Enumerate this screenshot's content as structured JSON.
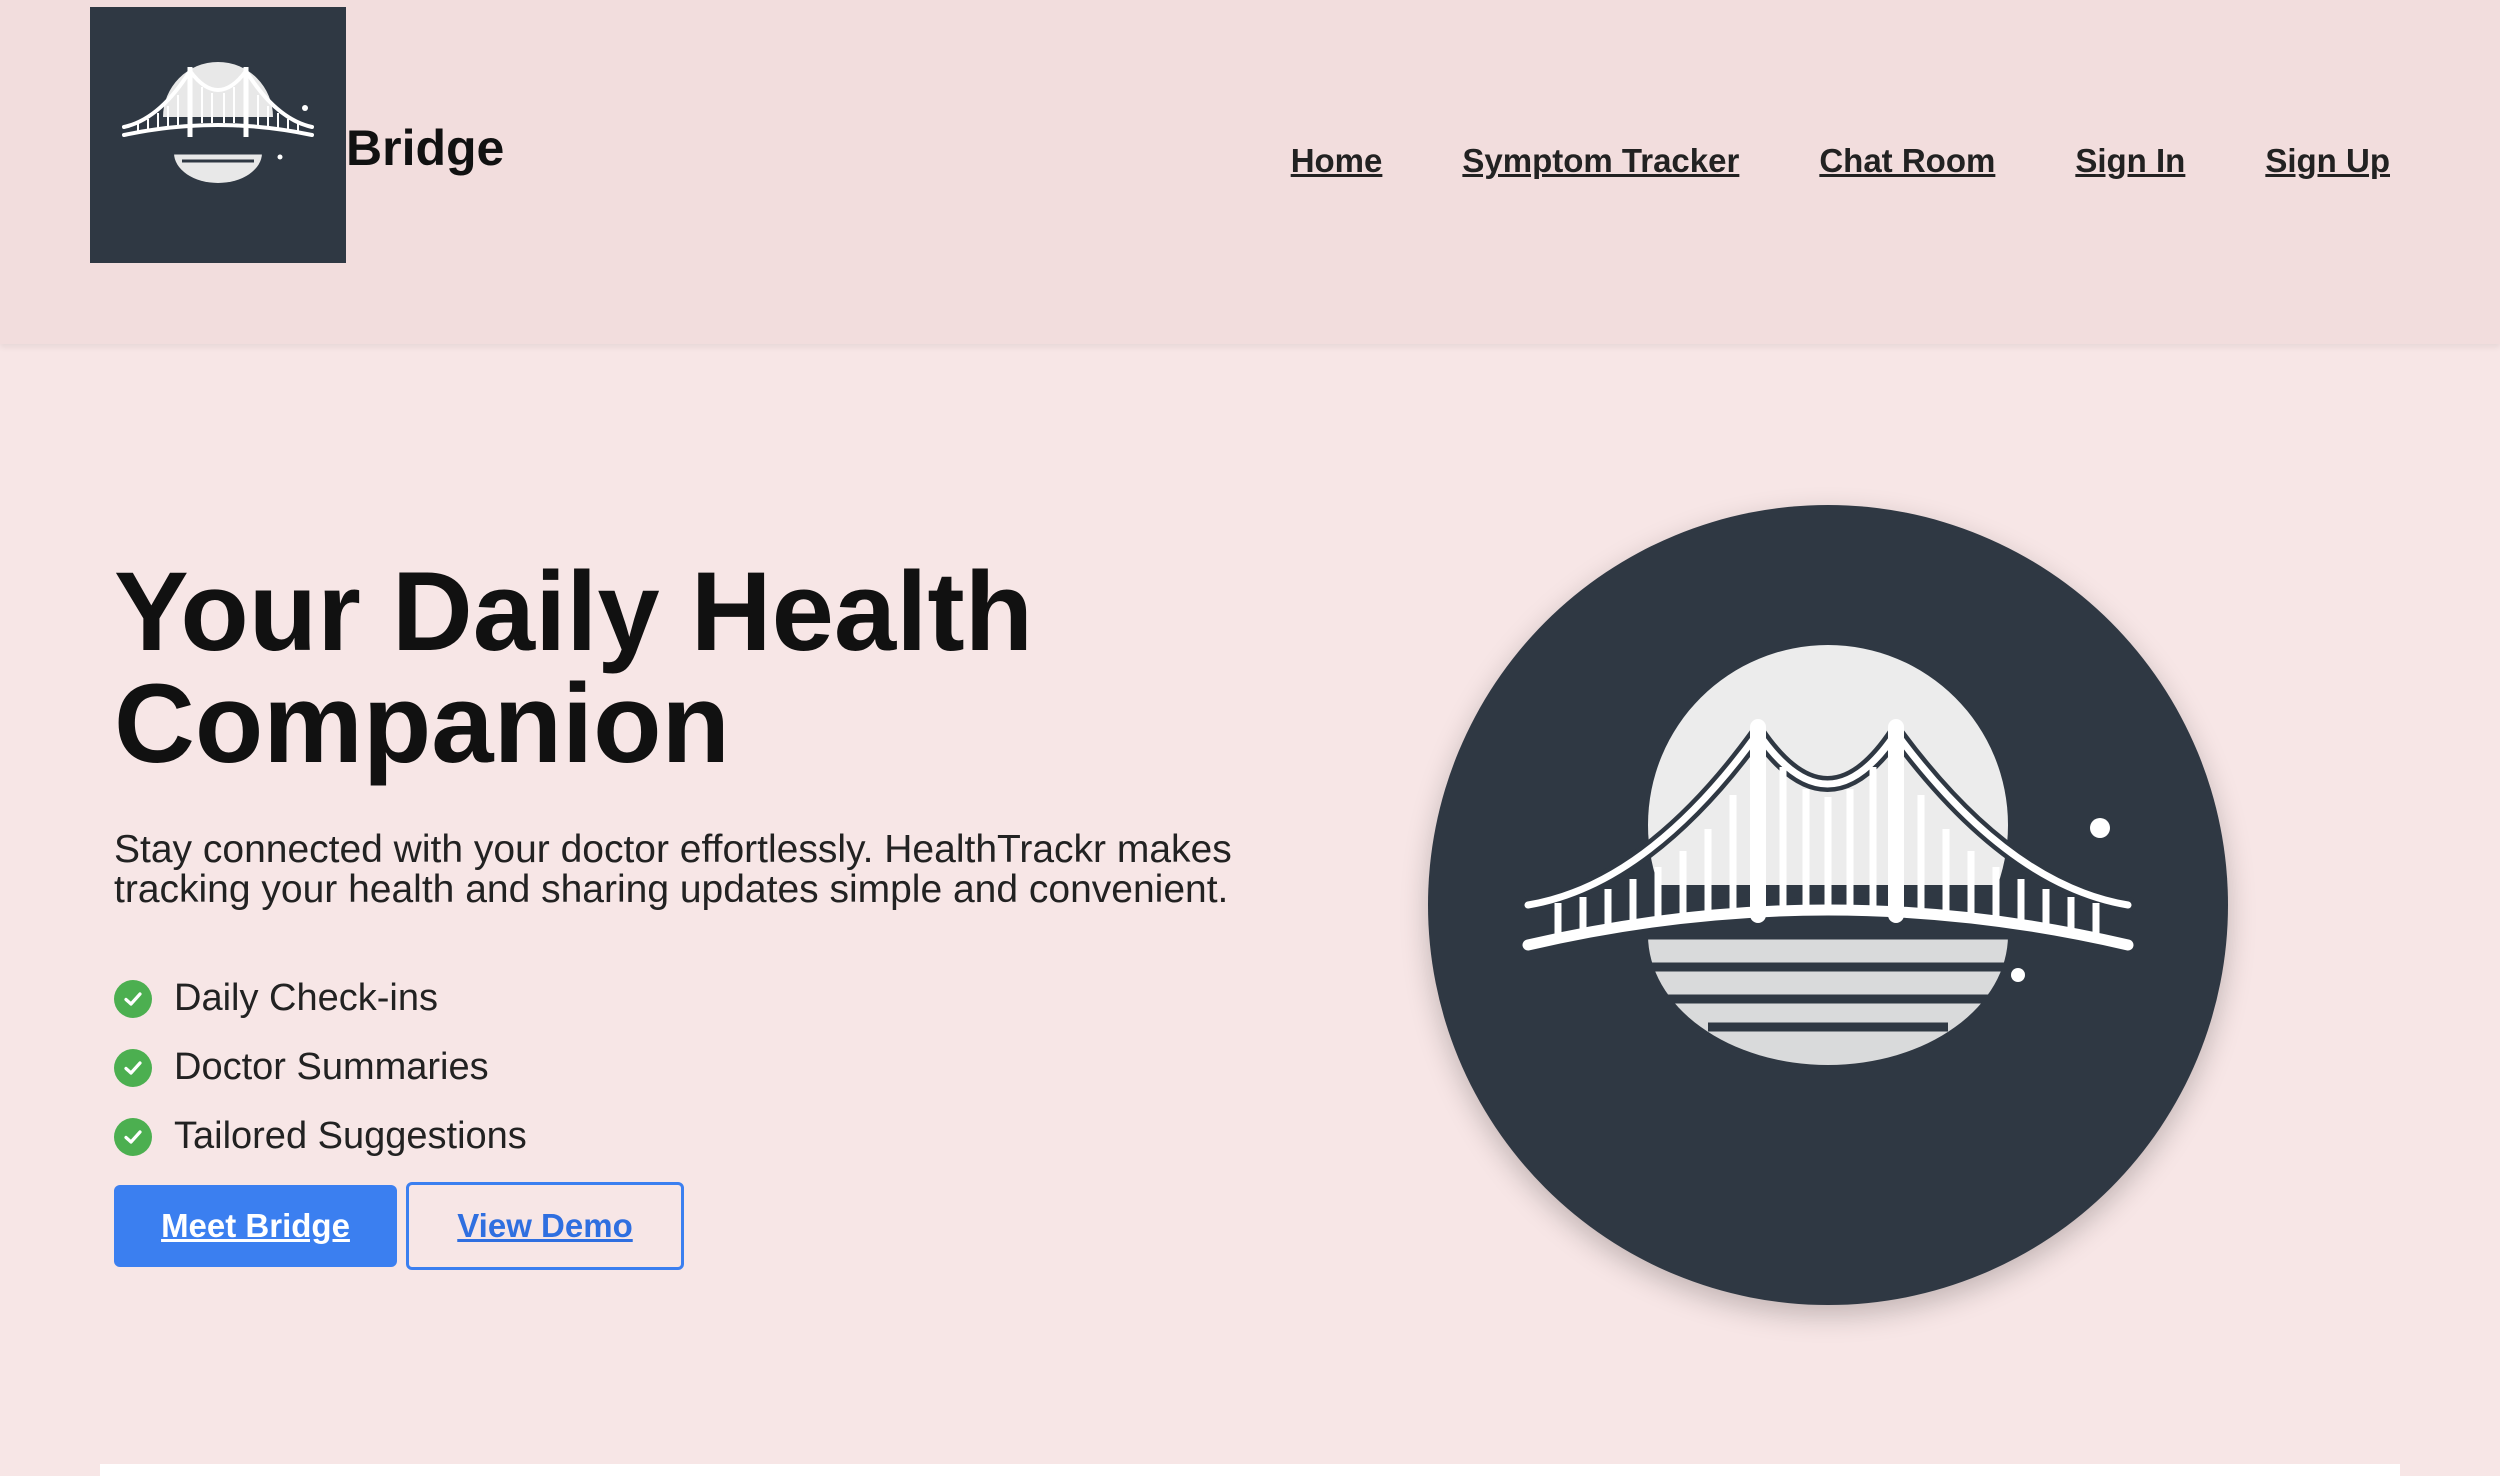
{
  "brand": {
    "name": "Bridge",
    "logo_icon": "bridge-logo-icon"
  },
  "nav": {
    "items": [
      {
        "label": "Home"
      },
      {
        "label": "Symptom Tracker"
      },
      {
        "label": "Chat Room"
      },
      {
        "label": "Sign In"
      },
      {
        "label": "Sign Up"
      }
    ]
  },
  "hero": {
    "title_line1": "Your Daily Health",
    "title_line2": "Companion",
    "description": "Stay connected with your doctor effortlessly. HealthTrackr makes tracking your health and sharing updates simple and convenient.",
    "features": [
      {
        "label": "Daily Check-ins",
        "icon": "check-circle-icon"
      },
      {
        "label": "Doctor Summaries",
        "icon": "check-circle-icon"
      },
      {
        "label": "Tailored Suggestions",
        "icon": "check-circle-icon"
      }
    ],
    "primary_button": "Meet Bridge",
    "secondary_button": "View Demo",
    "illustration_icon": "bridge-illustration-icon"
  },
  "colors": {
    "page_background": "#f7e6e6",
    "navbar_background": "#f2dddd",
    "logo_background": "#2f3843",
    "primary_blue": "#3b7ff0",
    "check_green": "#4caf50"
  }
}
